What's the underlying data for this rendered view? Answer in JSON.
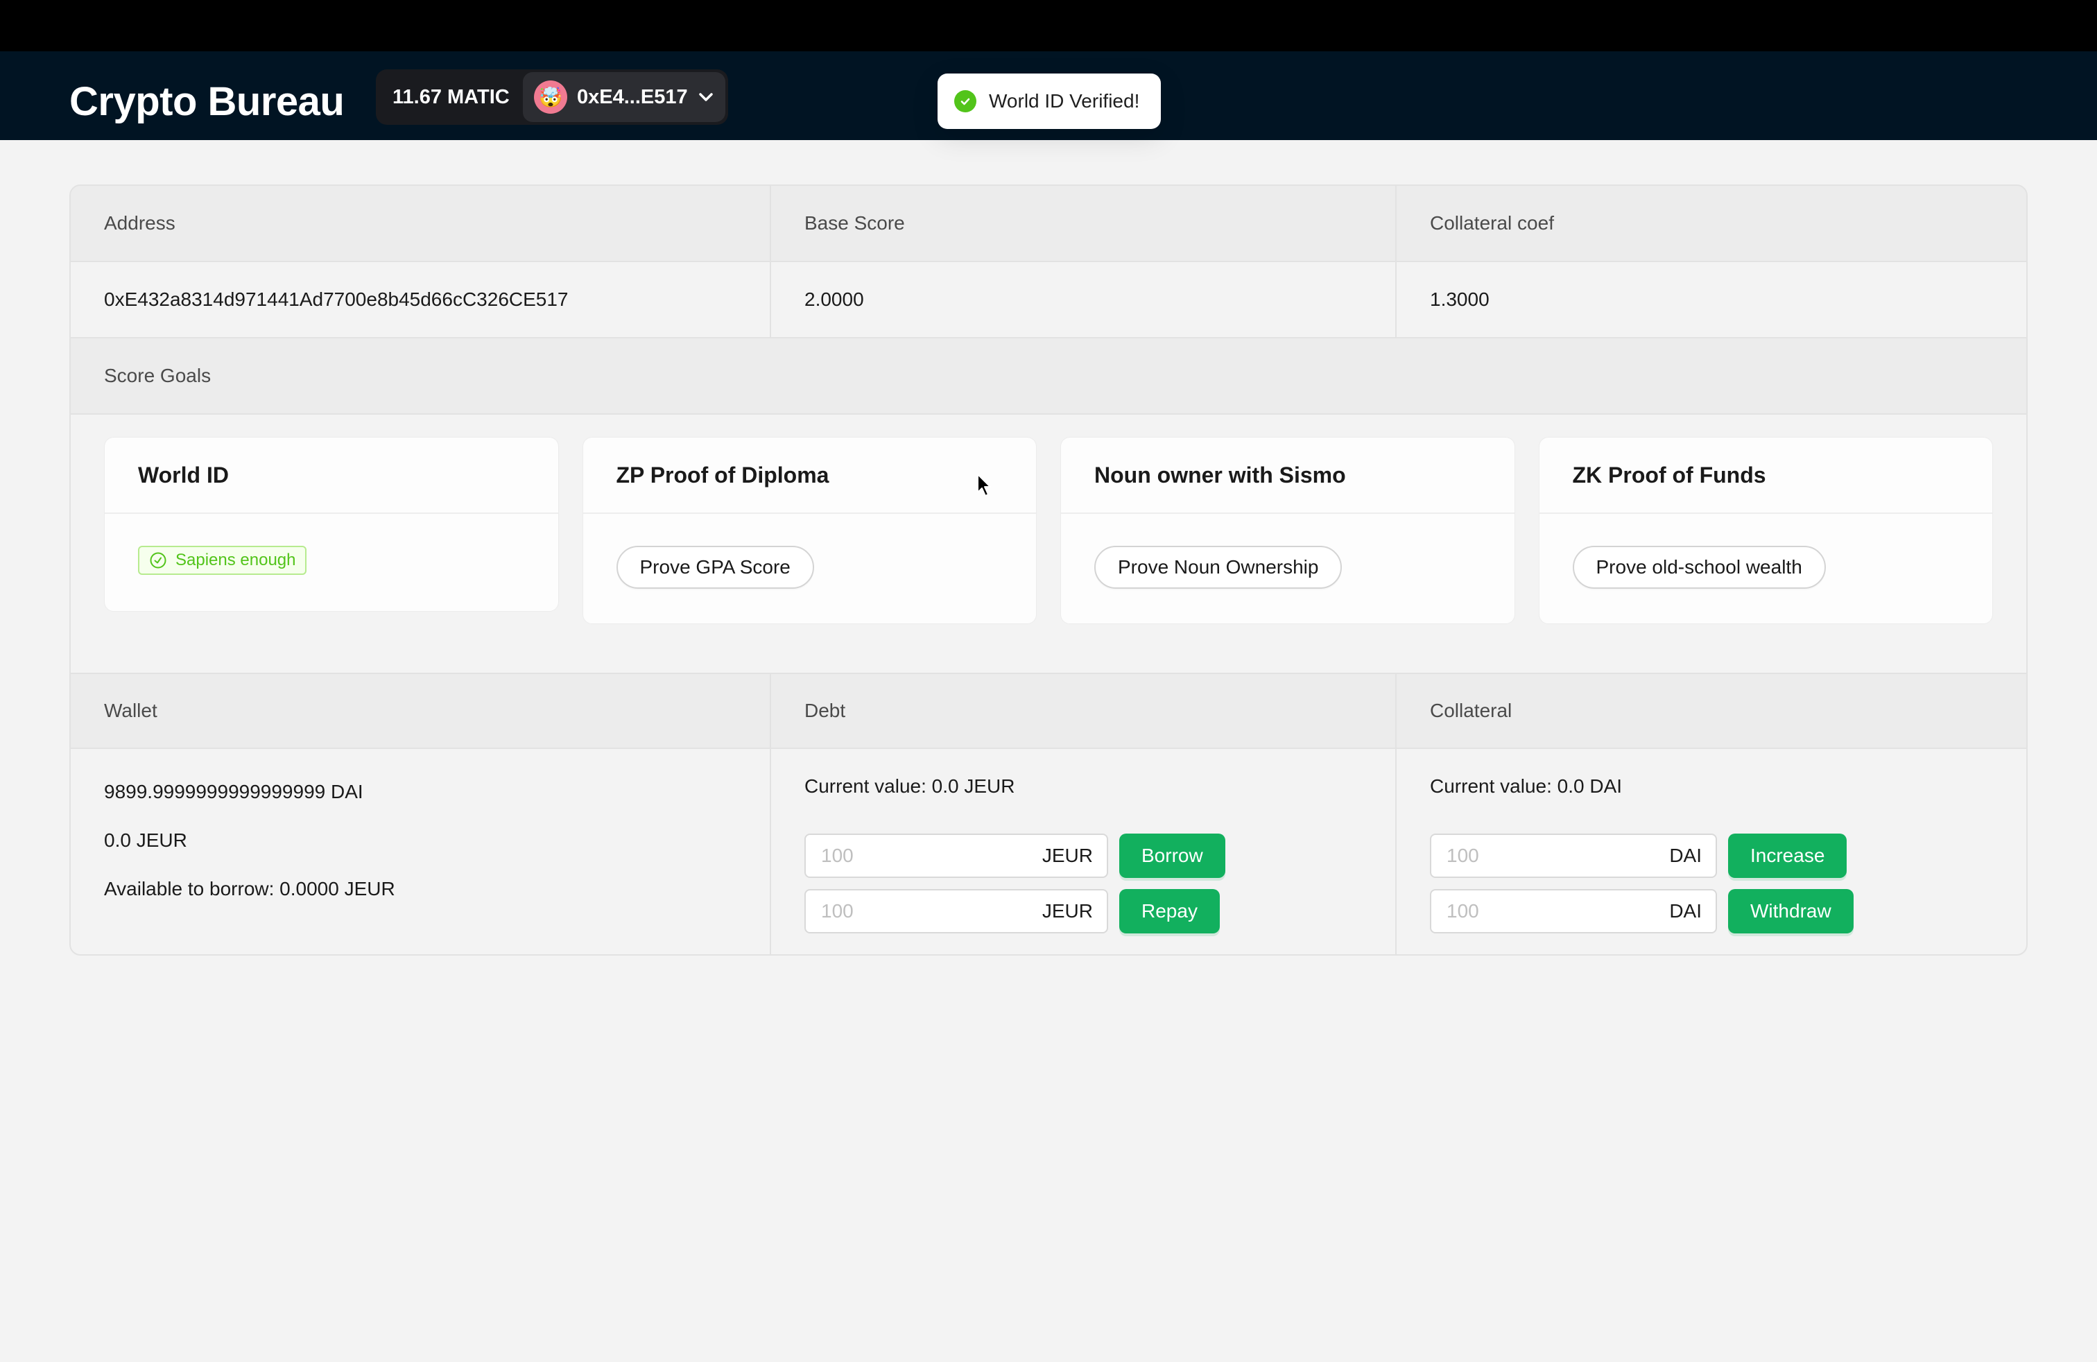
{
  "header": {
    "app_title": "Crypto Bureau",
    "balance": "11.67 MATIC",
    "account_short": "0xE4...E517",
    "avatar_emoji": "🤯"
  },
  "toast": {
    "message": "World ID Verified!",
    "status": "success"
  },
  "summary": {
    "headers": [
      "Address",
      "Base Score",
      "Collateral coef"
    ],
    "values": [
      "0xE432a8314d971441Ad7700e8b45d66cC326CE517",
      "2.0000",
      "1.3000"
    ]
  },
  "score_goals": {
    "title": "Score Goals",
    "cards": [
      {
        "title": "World ID",
        "status_tag": "Sapiens enough"
      },
      {
        "title": "ZP Proof of Diploma",
        "button": "Prove GPA Score"
      },
      {
        "title": "Noun owner with Sismo",
        "button": "Prove Noun Ownership"
      },
      {
        "title": "ZK Proof of Funds",
        "button": "Prove old-school wealth"
      }
    ]
  },
  "positions": {
    "headers": [
      "Wallet",
      "Debt",
      "Collateral"
    ],
    "wallet": {
      "dai_balance": "9899.9999999999999999 DAI",
      "jeur_balance": "0.0 JEUR",
      "available_to_borrow": "Available to borrow: 0.0000 JEUR"
    },
    "debt": {
      "current_value": "Current value: 0.0 JEUR",
      "borrow": {
        "placeholder": "100",
        "suffix": "JEUR",
        "button": "Borrow"
      },
      "repay": {
        "placeholder": "100",
        "suffix": "JEUR",
        "button": "Repay"
      }
    },
    "collateral": {
      "current_value": "Current value: 0.0 DAI",
      "increase": {
        "placeholder": "100",
        "suffix": "DAI",
        "button": "Increase"
      },
      "withdraw": {
        "placeholder": "100",
        "suffix": "DAI",
        "button": "Withdraw"
      }
    }
  },
  "colors": {
    "header_bg": "#011423",
    "primary_green": "#12b05e",
    "success_green": "#52c41a"
  }
}
